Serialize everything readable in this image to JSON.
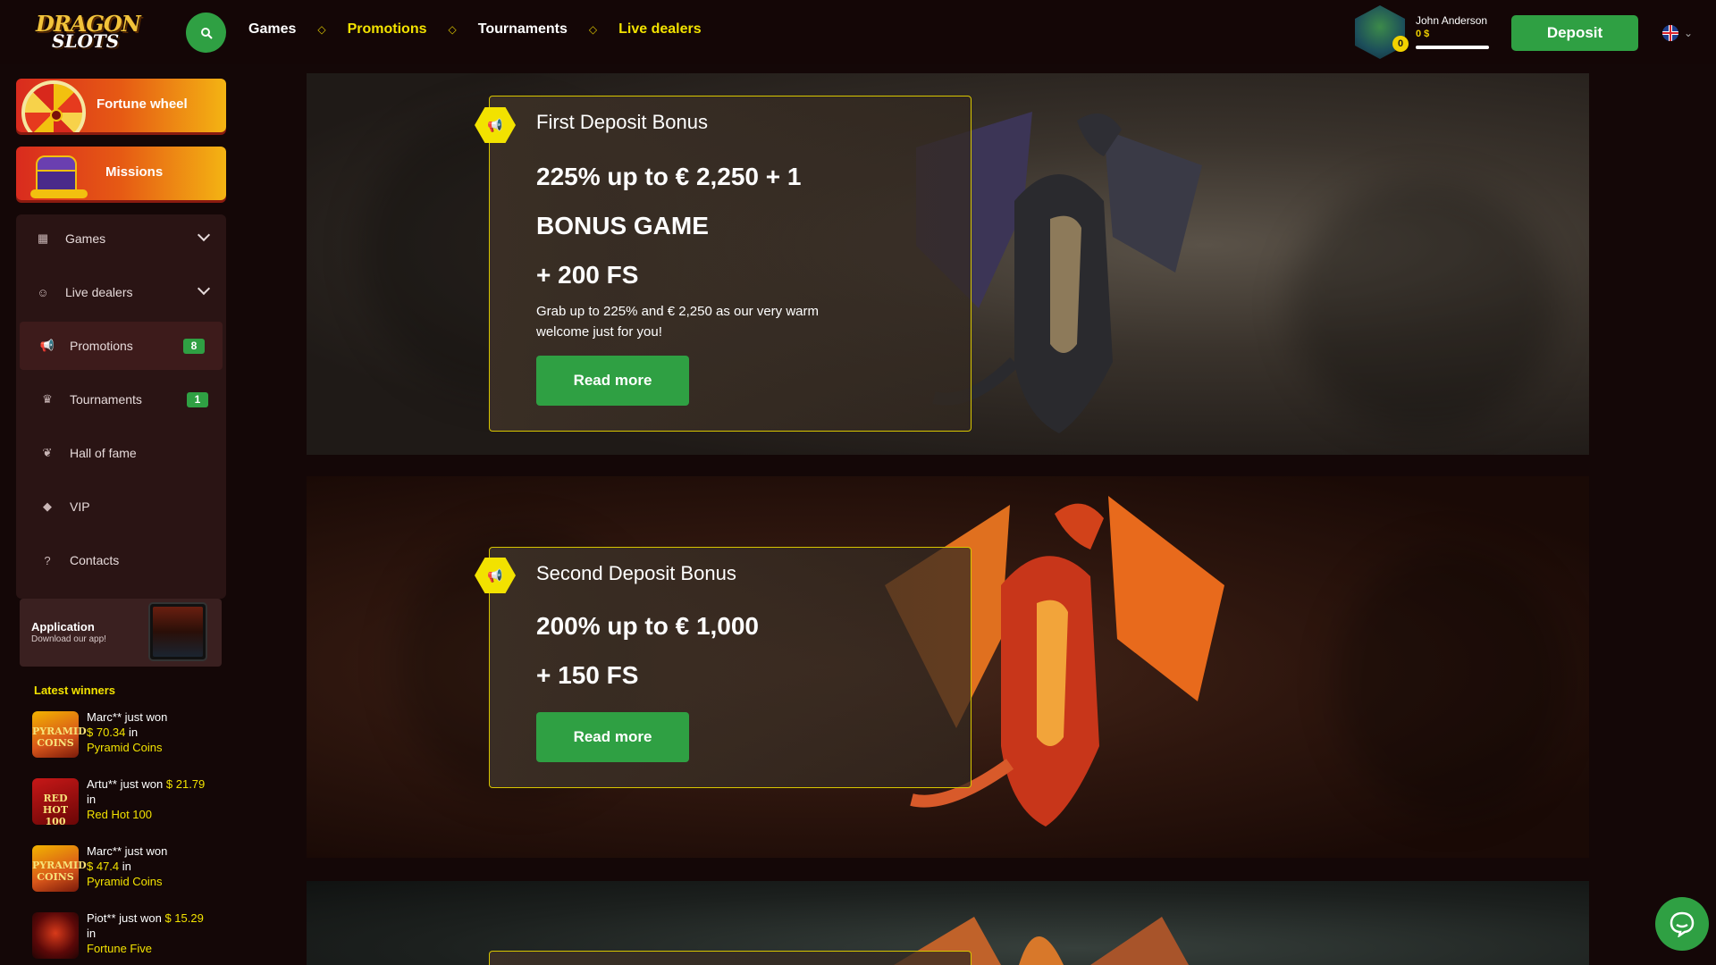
{
  "brand": {
    "logo_line1": "DRAGON",
    "logo_line2": "SLOTS"
  },
  "header": {
    "nav": [
      {
        "label": "Games",
        "highlight": false
      },
      {
        "label": "Promotions",
        "highlight": true
      },
      {
        "label": "Tournaments",
        "highlight": false
      },
      {
        "label": "Live dealers",
        "highlight": true
      }
    ],
    "user": {
      "name": "John Anderson",
      "balance": "0 $",
      "level": "0",
      "progress_fraction": 1.0
    },
    "deposit_label": "Deposit",
    "language": "EN"
  },
  "sidebar": {
    "cards": [
      {
        "label": "Fortune wheel"
      },
      {
        "label": "Missions"
      }
    ],
    "menu": [
      {
        "label": "Games",
        "icon": "games-icon"
      },
      {
        "label": "Live dealers",
        "icon": "live-dealers-icon"
      },
      {
        "label": "Promotions",
        "icon": "megaphone-icon",
        "badge": "8"
      },
      {
        "label": "Tournaments",
        "icon": "trophy-icon",
        "badge": "1"
      },
      {
        "label": "Hall of fame",
        "icon": "laurel-icon"
      },
      {
        "label": "VIP",
        "icon": "diamond-icon"
      },
      {
        "label": "Contacts",
        "icon": "help-icon"
      }
    ],
    "app": {
      "title": "Application",
      "subtitle": "Download our app!"
    },
    "winners_title": "Latest winners",
    "winners": [
      {
        "text": "Marc** just won",
        "amount": "$ 70.34",
        "in": "in",
        "game": "Pyramid Coins",
        "thumb": "PYRAMID COINS"
      },
      {
        "text": "Artu** just won",
        "amount": "$ 21.79",
        "in": "in",
        "game": "Red Hot 100",
        "thumb": "RED HOT 100"
      },
      {
        "text": "Marc** just won",
        "amount": "$ 47.4",
        "in": "in",
        "game": "Pyramid Coins",
        "thumb": "PYRAMID COINS"
      },
      {
        "text": "Piot** just won",
        "amount": "$ 15.29",
        "in": "in",
        "game": "Fortune Five",
        "thumb": ""
      }
    ]
  },
  "promotions": [
    {
      "title": "First Deposit Bonus",
      "lines": [
        "225% up to € 2,250 + 1",
        "BONUS GAME",
        "+ 200 FS"
      ],
      "description": "Grab up to 225% and € 2,250 as our very warm welcome just for you!",
      "button": "Read more"
    },
    {
      "title": "Second Deposit Bonus",
      "lines": [
        "200% up to € 1,000",
        "+ 150 FS"
      ],
      "description": "",
      "button": "Read more"
    }
  ],
  "colors": {
    "accent_green": "#2fa043",
    "accent_yellow": "#f2e200",
    "background": "#140707"
  }
}
